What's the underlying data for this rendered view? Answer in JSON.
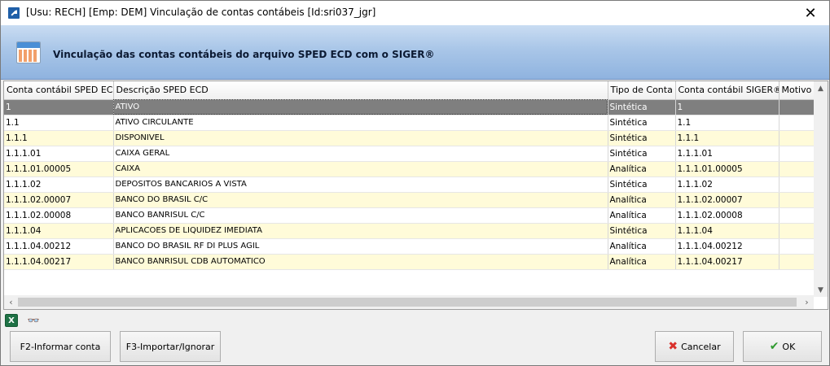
{
  "window": {
    "title": "[Usu: RECH] [Emp: DEM] Vinculação de contas contábeis [Id:sri037_jgr]",
    "close_glyph": "✕"
  },
  "banner": {
    "title": "Vinculação das contas contábeis do arquivo SPED ECD com o SIGER®",
    "icon": "calendar-grid-icon"
  },
  "table": {
    "columns": [
      "Conta contábil SPED ECD",
      "Descrição SPED ECD",
      "Tipo de Conta",
      "Conta contábil SIGER®",
      "Motivo"
    ],
    "rows": [
      {
        "conta": "1",
        "descricao": "ATIVO",
        "tipo": "Sintética",
        "siger": "1",
        "motivo": ""
      },
      {
        "conta": "1.1",
        "descricao": "ATIVO CIRCULANTE",
        "tipo": "Sintética",
        "siger": "1.1",
        "motivo": ""
      },
      {
        "conta": "1.1.1",
        "descricao": "DISPONIVEL",
        "tipo": "Sintética",
        "siger": "1.1.1",
        "motivo": ""
      },
      {
        "conta": "1.1.1.01",
        "descricao": "CAIXA GERAL",
        "tipo": "Sintética",
        "siger": "1.1.1.01",
        "motivo": ""
      },
      {
        "conta": "1.1.1.01.00005",
        "descricao": "CAIXA",
        "tipo": "Analítica",
        "siger": "1.1.1.01.00005",
        "motivo": ""
      },
      {
        "conta": "1.1.1.02",
        "descricao": "DEPOSITOS BANCARIOS A VISTA",
        "tipo": "Sintética",
        "siger": "1.1.1.02",
        "motivo": ""
      },
      {
        "conta": "1.1.1.02.00007",
        "descricao": "BANCO DO BRASIL C/C",
        "tipo": "Analítica",
        "siger": "1.1.1.02.00007",
        "motivo": ""
      },
      {
        "conta": "1.1.1.02.00008",
        "descricao": "BANCO BANRISUL C/C",
        "tipo": "Analítica",
        "siger": "1.1.1.02.00008",
        "motivo": ""
      },
      {
        "conta": "1.1.1.04",
        "descricao": "APLICACOES DE LIQUIDEZ IMEDIATA",
        "tipo": "Sintética",
        "siger": "1.1.1.04",
        "motivo": ""
      },
      {
        "conta": "1.1.1.04.00212",
        "descricao": "BANCO DO BRASIL RF DI PLUS AGIL",
        "tipo": "Analítica",
        "siger": "1.1.1.04.00212",
        "motivo": ""
      },
      {
        "conta": "1.1.1.04.00217",
        "descricao": "BANCO BANRISUL CDB AUTOMATICO",
        "tipo": "Analítica",
        "siger": "1.1.1.04.00217",
        "motivo": ""
      }
    ],
    "selected_row": 0
  },
  "tools": {
    "excel_glyph": "X",
    "view_glyph": "👓"
  },
  "buttons": {
    "f2_label": "F2-Informar conta",
    "f3_label": "F3-Importar/Ignorar",
    "cancel_label": "Cancelar",
    "ok_label": "OK"
  },
  "colors": {
    "row_alt": "#fffbd9",
    "row_selected": "#7f7f7f",
    "banner_accent": "#8fb3df"
  }
}
